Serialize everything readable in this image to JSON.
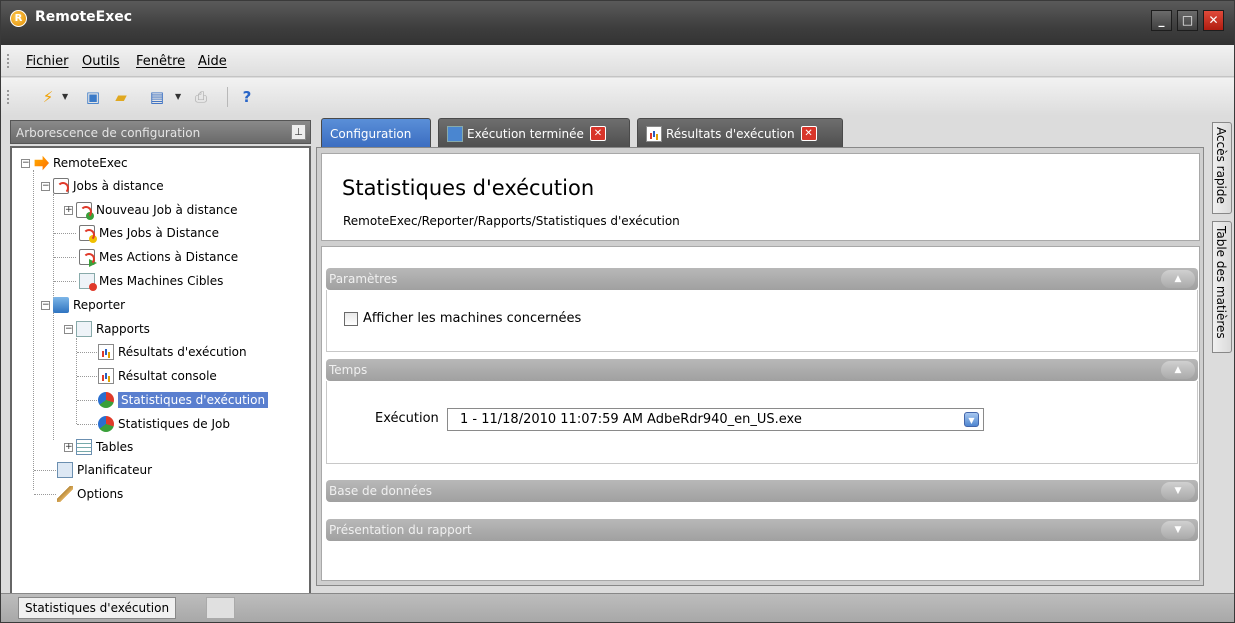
{
  "window": {
    "title": "RemoteExec",
    "app_icon": "R"
  },
  "menu": [
    {
      "label": "Fichier"
    },
    {
      "label": "Outils"
    },
    {
      "label": "Fenêtre"
    },
    {
      "label": "Aide"
    }
  ],
  "toolbar": {
    "icons": [
      "execute-icon",
      "new-icon",
      "open-folder-icon",
      "save-icon",
      "print-icon",
      "help-icon"
    ]
  },
  "left_panel": {
    "title": "Arborescence de configuration",
    "pin_glyph": "⊥",
    "tree": [
      {
        "label": "RemoteExec",
        "icon": "remoteexec-icon"
      },
      {
        "label": "Jobs à distance",
        "icon": "remote-jobs-icon"
      },
      {
        "label": "Nouveau Job à distance",
        "icon": "new-remote-job-icon"
      },
      {
        "label": "Mes Jobs à Distance",
        "icon": "my-jobs-icon"
      },
      {
        "label": "Mes Actions à Distance",
        "icon": "my-actions-icon"
      },
      {
        "label": "Mes Machines Cibles",
        "icon": "target-machines-icon"
      },
      {
        "label": "Reporter",
        "icon": "reporter-icon"
      },
      {
        "label": "Rapports",
        "icon": "reports-icon"
      },
      {
        "label": "Résultats d'exécution",
        "icon": "chart-icon"
      },
      {
        "label": "Résultat console",
        "icon": "chart-icon"
      },
      {
        "label": "Statistiques d'exécution",
        "icon": "pie-chart-icon"
      },
      {
        "label": "Statistiques de Job",
        "icon": "pie-chart-icon"
      },
      {
        "label": "Tables",
        "icon": "table-icon"
      },
      {
        "label": "Planificateur",
        "icon": "scheduler-icon"
      },
      {
        "label": "Options",
        "icon": "wrench-icon"
      }
    ]
  },
  "tabs": [
    {
      "label": "Configuration",
      "active": true
    },
    {
      "label": "Exécution terminée",
      "active": false
    },
    {
      "label": "Résultats d'exécution",
      "active": false
    }
  ],
  "main": {
    "title": "Statistiques d'exécution",
    "path": "RemoteExec/Reporter/Rapports/Statistiques d'exécution",
    "sections": {
      "parametres": {
        "title": "Paramètres",
        "checkbox_label": "Afficher les machines concernées",
        "checked": false
      },
      "temps": {
        "title": "Temps",
        "execution_label": "Exécution",
        "execution_value": "1 - 11/18/2010 11:07:59 AM AdbeRdr940_en_US.exe"
      },
      "base": {
        "title": "Base de données"
      },
      "presentation": {
        "title": "Présentation du rapport"
      }
    }
  },
  "side_tabs": [
    {
      "label": "Accès rapide"
    },
    {
      "label": "Table des matières"
    }
  ],
  "status": {
    "text": "Statistiques d'exécution"
  },
  "colors": {
    "accent": "#3a6cc0",
    "selection": "#5a7fcf",
    "close_red": "#d8352a"
  }
}
